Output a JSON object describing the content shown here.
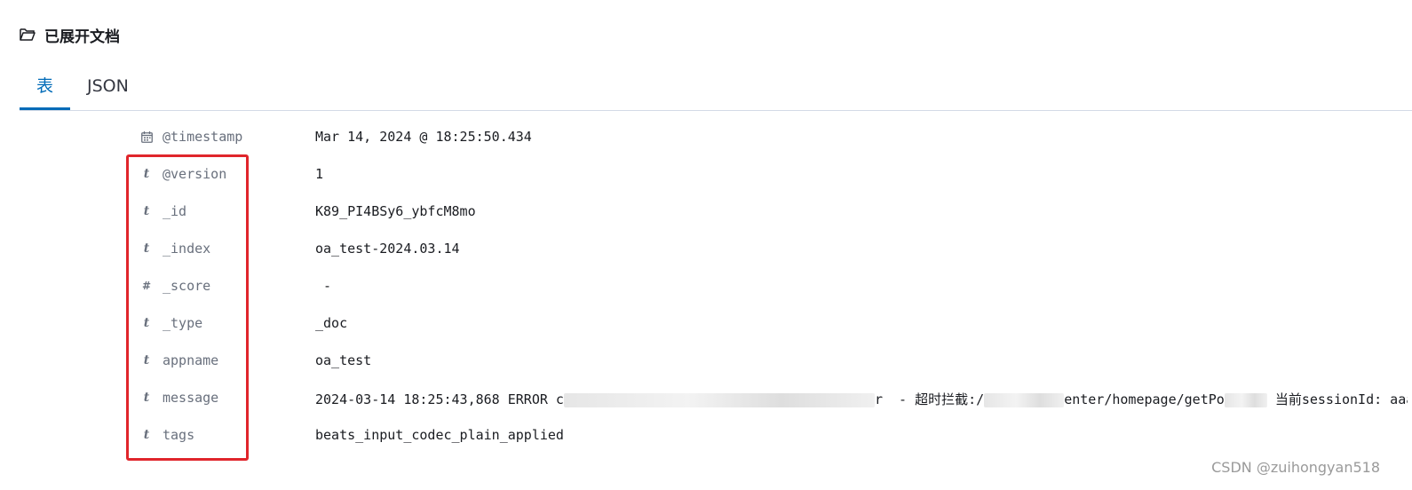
{
  "header": {
    "icon": "folder-open-icon",
    "title": "已展开文档"
  },
  "tabs": [
    {
      "label": "表",
      "active": true
    },
    {
      "label": "JSON",
      "active": false
    }
  ],
  "fields": [
    {
      "icon": "calendar-icon",
      "type_glyph": "",
      "name": "@timestamp",
      "value": "Mar 14, 2024 @ 18:25:50.434"
    },
    {
      "icon": "string-type-icon",
      "type_glyph": "t",
      "name": "@version",
      "value": "1"
    },
    {
      "icon": "string-type-icon",
      "type_glyph": "t",
      "name": "_id",
      "value": "K89_PI4BSy6_ybfcM8mo"
    },
    {
      "icon": "string-type-icon",
      "type_glyph": "t",
      "name": "_index",
      "value": "oa_test-2024.03.14"
    },
    {
      "icon": "number-type-icon",
      "type_glyph": "#",
      "name": "_score",
      "value": " -"
    },
    {
      "icon": "string-type-icon",
      "type_glyph": "t",
      "name": "_type",
      "value": "_doc"
    },
    {
      "icon": "string-type-icon",
      "type_glyph": "t",
      "name": "appname",
      "value": "oa_test"
    },
    {
      "icon": "string-type-icon",
      "type_glyph": "t",
      "name": "message",
      "value_parts": [
        "2024-03-14 18:25:43,868 ERROR c",
        "r  - 超时拦截:/",
        "enter/homepage/getPo",
        " 当前sessionId: aaa"
      ]
    },
    {
      "icon": "string-type-icon",
      "type_glyph": "t",
      "name": "tags",
      "value": "beats_input_codec_plain_applied"
    }
  ],
  "colors": {
    "accent": "#006bb8",
    "highlight_border": "#e0252b",
    "field_name": "#69707d"
  },
  "watermark": "CSDN @zuihongyan518"
}
